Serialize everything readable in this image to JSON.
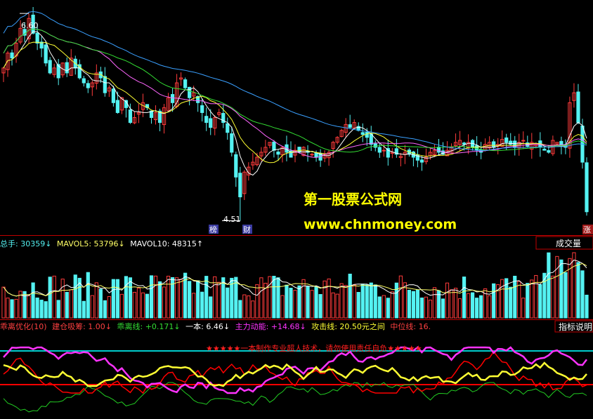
{
  "colors": {
    "up": "#ff3b3b",
    "down": "#54f2f2",
    "ma5": "#ffffff",
    "ma10": "#ffff33",
    "ma20": "#ff66ff",
    "ma30": "#33dd33",
    "ma60": "#3aa0ff",
    "separator": "#c00000",
    "cyan_line": "#00cccc",
    "red_line": "#ff0000",
    "magenta_line": "#ff33ff",
    "yellow_line": "#ffff33",
    "green_line": "#22cc22"
  },
  "price_panel": {
    "high_label": "6.60",
    "low_label": "4.51",
    "badges": [
      "榜",
      "财",
      "涨"
    ],
    "watermark_cn": "第一股票公式网",
    "watermark_url": "www.chnmoney.com"
  },
  "volume_panel": {
    "legend": [
      {
        "text": "总手: 30359",
        "color": "#54f2f2",
        "arrow": "↓"
      },
      {
        "text": "MAVOL5: 53796",
        "color": "#ffff66",
        "arrow": "↓"
      },
      {
        "text": "MAVOL10: 48315",
        "color": "#ffffff",
        "arrow": "↑"
      }
    ],
    "label": "成交量"
  },
  "indicator_panel": {
    "legend": [
      {
        "text": "乖离优化(10)",
        "color": "#ff4040"
      },
      {
        "text": "建仓吸筹: 1.00",
        "color": "#ff4040",
        "arrow": "↓"
      },
      {
        "text": "乖离线: +0.171",
        "color": "#33dd33",
        "arrow": "↓"
      },
      {
        "text": "一本: 6.46",
        "color": "#ffffff",
        "arrow": "↓"
      },
      {
        "text": "主力动能: +14.68",
        "color": "#ff33ff",
        "arrow": "↓"
      },
      {
        "text": "攻击线: 20.50元之间",
        "color": "#ffff33",
        "arrow": ""
      },
      {
        "text": "中位线: 16.",
        "color": "#ff4040",
        "arrow": ""
      }
    ],
    "label": "指标说明",
    "banner": "★★★★★一本制作专业超人技术，请勿使用责任自负★★★★★"
  },
  "chart_data": [
    {
      "type": "candlestick",
      "title": "",
      "annotations": [
        "6.60",
        "4.51"
      ],
      "series_names": [
        "MA5",
        "MA10",
        "MA20",
        "MA30",
        "MA60"
      ],
      "ylim": [
        4.4,
        6.7
      ],
      "closes": [
        6.05,
        6.2,
        6.15,
        6.3,
        6.45,
        6.38,
        6.55,
        6.4,
        6.3,
        6.25,
        6.1,
        6.0,
        6.05,
        5.95,
        6.1,
        6.0,
        6.15,
        6.05,
        5.95,
        5.9,
        5.85,
        5.9,
        6.0,
        5.95,
        5.8,
        5.85,
        5.7,
        5.6,
        5.75,
        5.65,
        5.5,
        5.55,
        5.6,
        5.7,
        5.65,
        5.55,
        5.6,
        5.5,
        5.65,
        5.75,
        5.7,
        5.9,
        5.95,
        5.85,
        5.75,
        5.8,
        5.7,
        5.6,
        5.5,
        5.45,
        5.55,
        5.6,
        5.5,
        5.4,
        5.2,
        4.95,
        4.75,
        5.0,
        5.05,
        5.1,
        5.15,
        5.2,
        5.25,
        5.3,
        5.22,
        5.18,
        5.25,
        5.2,
        5.15,
        5.22,
        5.2,
        5.25,
        5.2,
        5.18,
        5.15,
        5.12,
        5.18,
        5.2,
        5.3,
        5.35,
        5.42,
        5.48,
        5.45,
        5.5,
        5.42,
        5.38,
        5.35,
        5.28,
        5.25,
        5.2,
        5.22,
        5.15,
        5.2,
        5.18,
        5.16,
        5.2,
        5.18,
        5.15,
        5.12,
        5.1,
        5.15,
        5.2,
        5.22,
        5.2,
        5.18,
        5.22,
        5.25,
        5.3,
        5.32,
        5.28,
        5.3,
        5.25,
        5.22,
        5.2,
        5.28,
        5.3,
        5.25,
        5.28,
        5.33,
        5.3,
        5.28,
        5.25,
        5.3,
        5.32,
        5.26,
        5.3,
        5.28,
        5.25,
        5.22,
        5.2,
        5.32,
        5.3,
        5.26,
        5.25,
        5.7,
        5.8,
        5.5,
        5.1,
        4.6
      ]
    },
    {
      "type": "bar",
      "title": "",
      "series_names": [
        "总手",
        "MAVOL5",
        "MAVOL10"
      ],
      "values_mavol": {
        "MAVOL5": 53796,
        "MAVOL10": 48315,
        "总手": 30359
      }
    },
    {
      "type": "line",
      "title": "乖离优化(10)",
      "series_names": [
        "建仓吸筹",
        "乖离线",
        "一本",
        "主力动能",
        "攻击线",
        "中位线"
      ],
      "values": {
        "建仓吸筹": 1.0,
        "乖离线": 0.171,
        "一本": 6.46,
        "主力动能": 14.68
      }
    }
  ]
}
